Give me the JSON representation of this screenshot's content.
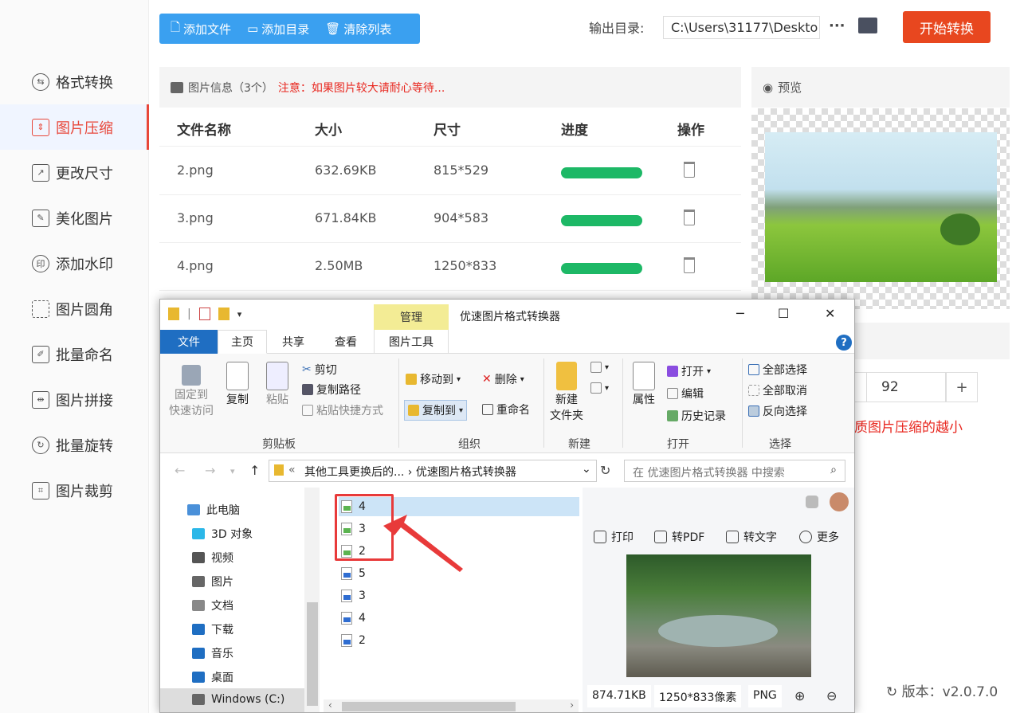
{
  "sidebar": {
    "items": [
      {
        "label": "格式转换",
        "icon": "convert-icon"
      },
      {
        "label": "图片压缩",
        "icon": "compress-icon",
        "active": true
      },
      {
        "label": "更改尺寸",
        "icon": "resize-icon"
      },
      {
        "label": "美化图片",
        "icon": "beautify-icon"
      },
      {
        "label": "添加水印",
        "icon": "watermark-icon"
      },
      {
        "label": "图片圆角",
        "icon": "round-corner-icon"
      },
      {
        "label": "批量命名",
        "icon": "rename-icon"
      },
      {
        "label": "图片拼接",
        "icon": "merge-icon"
      },
      {
        "label": "批量旋转",
        "icon": "rotate-icon"
      },
      {
        "label": "图片裁剪",
        "icon": "crop-icon"
      }
    ]
  },
  "toolbar": {
    "add_file": "添加文件",
    "add_dir": "添加目录",
    "clear_list": "清除列表",
    "output_label": "输出目录:",
    "output_path": "C:\\Users\\31177\\Deskto",
    "more": "···",
    "start": "开始转换"
  },
  "info": {
    "title": "图片信息（3个）",
    "warning": "注意：如果图片较大请耐心等待..."
  },
  "table": {
    "headers": [
      "文件名称",
      "大小",
      "尺寸",
      "进度",
      "操作"
    ],
    "rows": [
      {
        "name": "2.png",
        "size": "632.69KB",
        "dim": "815*529",
        "progress": 1.0
      },
      {
        "name": "3.png",
        "size": "671.84KB",
        "dim": "904*583",
        "progress": 1.0
      },
      {
        "name": "4.png",
        "size": "2.50MB",
        "dim": "1250*833",
        "progress": 1.0
      }
    ]
  },
  "preview": {
    "title": "预览"
  },
  "quality": {
    "value": "92",
    "plus": "+",
    "hint": "质图片压缩的越小"
  },
  "version": "版本：v2.0.7.0",
  "explorer": {
    "manage_tab": "管理",
    "title": "优速图片格式转换器",
    "tabs": [
      "文件",
      "主页",
      "共享",
      "查看",
      "图片工具"
    ],
    "help": "?",
    "ribbon": {
      "pin_l1": "固定到",
      "pin_l2": "快速访问",
      "copy": "复制",
      "paste": "粘贴",
      "cut": "剪切",
      "copy_path": "复制路径",
      "paste_shortcut": "粘贴快捷方式",
      "clipboard": "剪贴板",
      "move_to": "移动到",
      "copy_to": "复制到",
      "delete": "删除",
      "rename": "重命名",
      "organize": "组织",
      "new_folder_l1": "新建",
      "new_folder_l2": "文件夹",
      "new_group": "新建",
      "properties": "属性",
      "open": "打开",
      "edit": "编辑",
      "history": "历史记录",
      "open_group": "打开",
      "select_all": "全部选择",
      "select_none": "全部取消",
      "invert": "反向选择",
      "select_group": "选择"
    },
    "address": "其他工具更换后的...  ›  优速图片格式转换器",
    "address_prefix": "«",
    "search_placeholder": "在 优速图片格式转换器 中搜索",
    "nav": [
      {
        "label": "此电脑",
        "color": "#4a90d9"
      },
      {
        "label": "3D 对象",
        "color": "#2bb7e8"
      },
      {
        "label": "视频",
        "color": "#555555"
      },
      {
        "label": "图片",
        "color": "#666666"
      },
      {
        "label": "文档",
        "color": "#888888"
      },
      {
        "label": "下载",
        "color": "#1f6ec2"
      },
      {
        "label": "音乐",
        "color": "#1f6ec2"
      },
      {
        "label": "桌面",
        "color": "#1f6ec2"
      },
      {
        "label": "Windows (C:)",
        "color": "#666666"
      }
    ],
    "files": [
      {
        "name": "4",
        "type": "green"
      },
      {
        "name": "3",
        "type": "green"
      },
      {
        "name": "2",
        "type": "green"
      },
      {
        "name": "5",
        "type": "blue"
      },
      {
        "name": "3",
        "type": "blue"
      },
      {
        "name": "4",
        "type": "blue"
      },
      {
        "name": "2",
        "type": "blue"
      }
    ],
    "preview_pane": {
      "print": "打印",
      "to_pdf": "转PDF",
      "to_text": "转文字",
      "more": "更多",
      "size": "874.71KB",
      "dim": "1250*833像素",
      "format": "PNG"
    }
  },
  "colors": {
    "accent": "#e8473a",
    "toolbar_blue": "#3aa0f0",
    "start_btn": "#e8471f",
    "progress_green": "#1db866",
    "explorer_file_tab": "#1f6ec2",
    "highlight_box": "#e83a3a"
  }
}
